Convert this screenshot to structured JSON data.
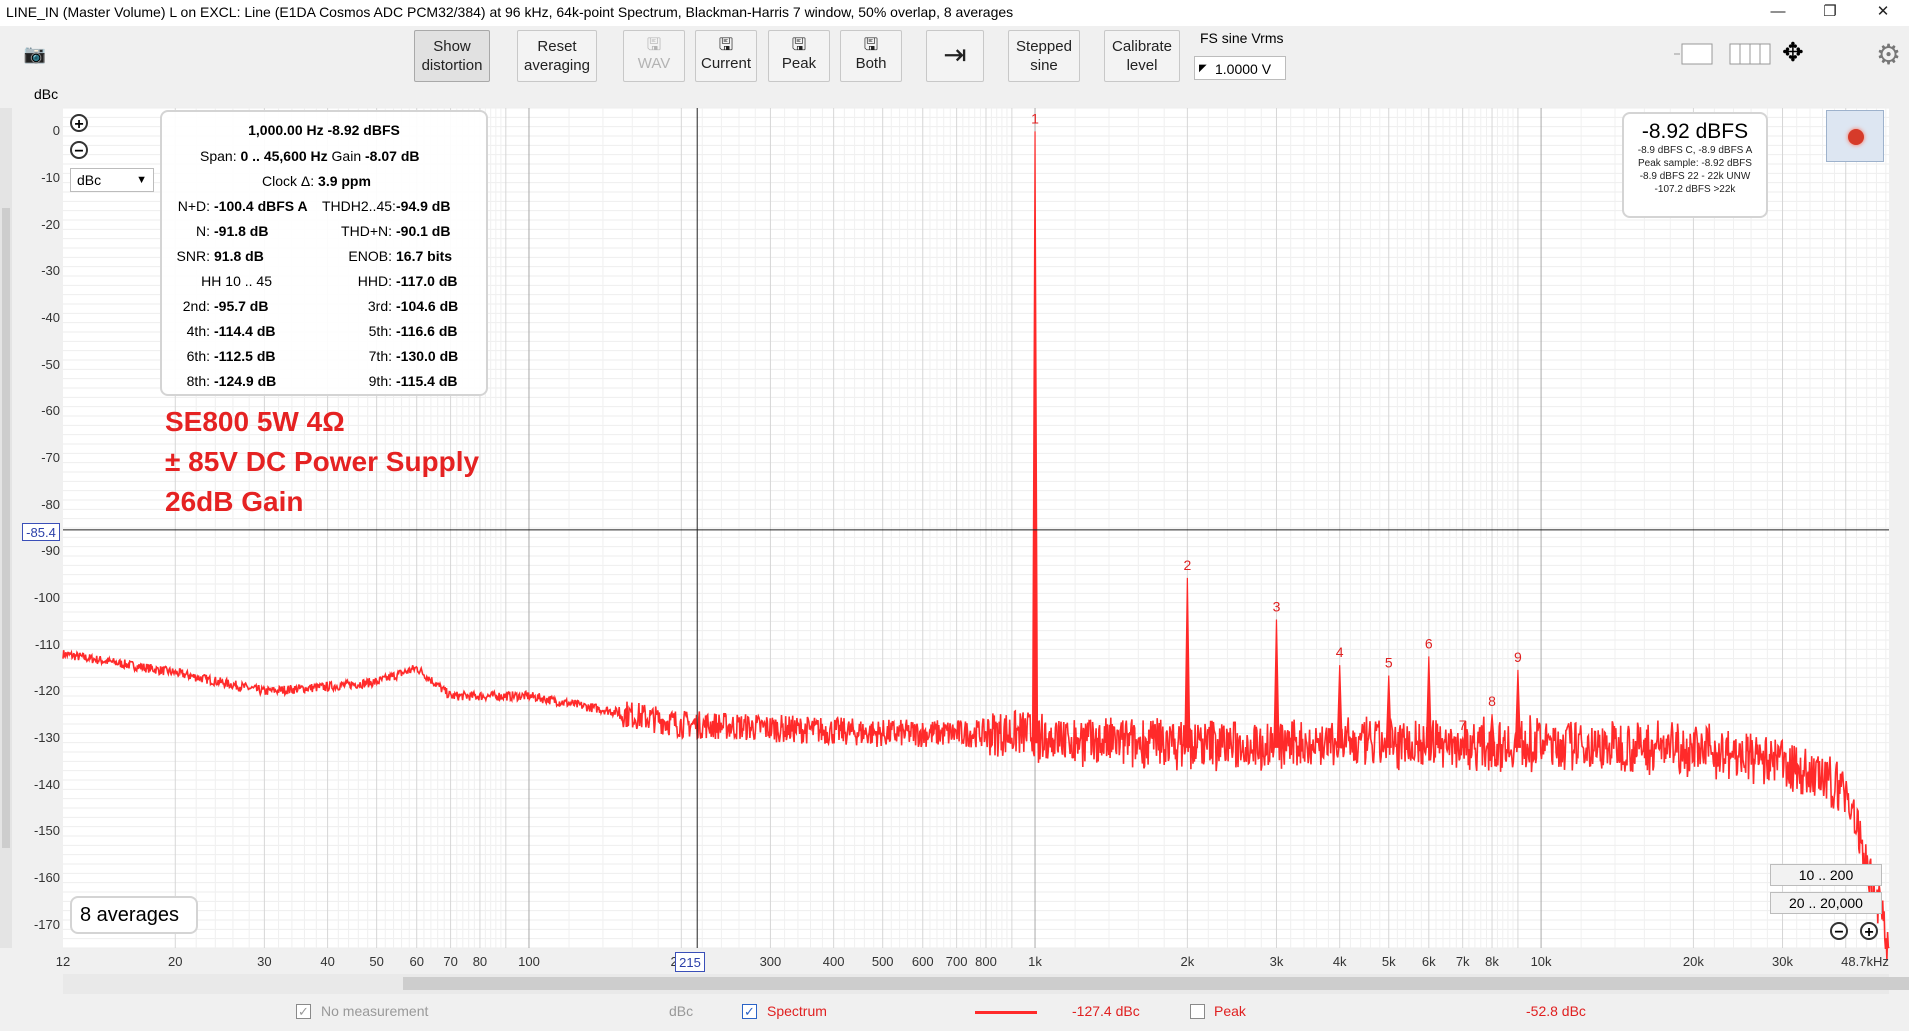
{
  "window": {
    "title": "LINE_IN (Master Volume) L on EXCL: Line (E1DA Cosmos ADC PCM32/384) at 96 kHz, 64k-point Spectrum, Blackman-Harris 7 window, 50% overlap, 8 averages",
    "minimize_glyph": "—",
    "restore_glyph": "❐",
    "close_glyph": "✕"
  },
  "toolbar": {
    "camera_glyph": "📷",
    "show_distortion": [
      "Show",
      "distortion"
    ],
    "reset_averaging": [
      "Reset",
      "averaging"
    ],
    "wav": "WAV",
    "current": "Current",
    "peak": "Peak",
    "both": "Both",
    "save_glyph": "🖫",
    "export_glyph": "⇥",
    "stepped_sine": [
      "Stepped",
      "sine"
    ],
    "calibrate_level": [
      "Calibrate",
      "level"
    ],
    "fs_label": "FS sine Vrms",
    "fs_value": "1.0000 V",
    "arrows_glyph": "✥",
    "gear_glyph": "⚙"
  },
  "plot": {
    "y_unit": "dBc",
    "y_ticks": [
      "0",
      "-10",
      "-20",
      "-30",
      "-40",
      "-50",
      "-60",
      "-70",
      "-80",
      "-90",
      "-100",
      "-110",
      "-120",
      "-130",
      "-140",
      "-150",
      "-160",
      "-170"
    ],
    "x_ticks": [
      "12",
      "20",
      "30",
      "40",
      "50",
      "60",
      "70",
      "80",
      "100",
      "200",
      "300",
      "400",
      "500",
      "600",
      "700",
      "800",
      "1k",
      "2k",
      "3k",
      "4k",
      "5k",
      "6k",
      "7k",
      "8k",
      "10k",
      "20k",
      "30k",
      "48.7kHz"
    ],
    "cursor_y_value": "-85.4",
    "cursor_x_value": "215",
    "unit_select": "dBc",
    "zoom_in_glyph": "+",
    "zoom_out_glyph": "−",
    "averages_label": "8 averages",
    "range_low": "10 .. 200",
    "range_high": "20 .. 20,000"
  },
  "stats": {
    "header": "1,000.00 Hz  -8.92 dBFS",
    "span_label": "Span:",
    "span_value": "0 .. 45,600 Hz",
    "gain_label": "Gain",
    "gain_value": "-8.07 dB",
    "clock_label": "Clock Δ:",
    "clock_value": "3.9 ppm",
    "nd_label": "N+D:",
    "nd_value": "-100.4 dBFS A",
    "thd_label": "THDH2..45:",
    "thd_value": "-94.9 dB",
    "n_label": "N:",
    "n_value": "-91.8 dB",
    "thdn_label": "THD+N:",
    "thdn_value": "-90.1 dB",
    "snr_label": "SNR:",
    "snr_value": "91.8 dB",
    "enob_label": "ENOB:",
    "enob_value": "16.7 bits",
    "hh_label": "HH 10 .. 45",
    "hhd_label": "HHD:",
    "hhd_value": "-117.0 dB",
    "h2_label": "2nd:",
    "h2_value": "-95.7 dB",
    "h3_label": "3rd:",
    "h3_value": "-104.6 dB",
    "h4_label": "4th:",
    "h4_value": "-114.4 dB",
    "h5_label": "5th:",
    "h5_value": "-116.6 dB",
    "h6_label": "6th:",
    "h6_value": "-112.5 dB",
    "h7_label": "7th:",
    "h7_value": "-130.0 dB",
    "h8_label": "8th:",
    "h8_value": "-124.9 dB",
    "h9_label": "9th:",
    "h9_value": "-115.4 dB"
  },
  "overlay": {
    "line1": "SE800 5W 4Ω",
    "line2": "± 85V DC Power Supply",
    "line3": "26dB Gain",
    "color": "#e52222"
  },
  "level": {
    "main": "-8.92 dBFS",
    "sub1": "-8.9 dBFS C, -8.9 dBFS A",
    "sub2": "Peak sample: -8.92 dBFS",
    "sub3": "-8.9 dBFS 22 - 22k UNW",
    "sub4": "-107.2 dBFS >22k"
  },
  "status": {
    "no_measurement": "No measurement",
    "no_measurement_unit": "dBc",
    "spectrum": "Spectrum",
    "spectrum_value": "-127.4 dBc",
    "peak": "Peak",
    "peak_value": "-52.8 dBc",
    "check_glyph": "✓"
  },
  "chart_data": {
    "type": "line",
    "x_scale": "log",
    "xlim": [
      12,
      48700
    ],
    "ylim": [
      -175,
      5
    ],
    "grid": true,
    "ylabel": "dBc",
    "color": "#ff2a2a",
    "noise_floor": [
      [
        12,
        -112
      ],
      [
        20,
        -116
      ],
      [
        30,
        -120
      ],
      [
        40,
        -119
      ],
      [
        50,
        -118
      ],
      [
        60,
        -115
      ],
      [
        70,
        -121
      ],
      [
        100,
        -121
      ],
      [
        200,
        -127
      ],
      [
        500,
        -129
      ],
      [
        1000,
        -129
      ],
      [
        2000,
        -130
      ],
      [
        5000,
        -130
      ],
      [
        10000,
        -130
      ],
      [
        20000,
        -131
      ],
      [
        30000,
        -134
      ],
      [
        40000,
        -140
      ],
      [
        48700,
        -172
      ]
    ],
    "harmonics": [
      {
        "label": "1",
        "x": 1000,
        "y": 0
      },
      {
        "label": "2",
        "x": 2000,
        "y": -95.7
      },
      {
        "label": "3",
        "x": 3000,
        "y": -104.6
      },
      {
        "label": "4",
        "x": 4000,
        "y": -114.4
      },
      {
        "label": "5",
        "x": 5000,
        "y": -116.6
      },
      {
        "label": "6",
        "x": 6000,
        "y": -112.5
      },
      {
        "label": "7",
        "x": 7000,
        "y": -130.0
      },
      {
        "label": "8",
        "x": 8000,
        "y": -124.9
      },
      {
        "label": "9",
        "x": 9000,
        "y": -115.4
      }
    ],
    "cursor": {
      "x": 215,
      "y": -85.4
    }
  }
}
